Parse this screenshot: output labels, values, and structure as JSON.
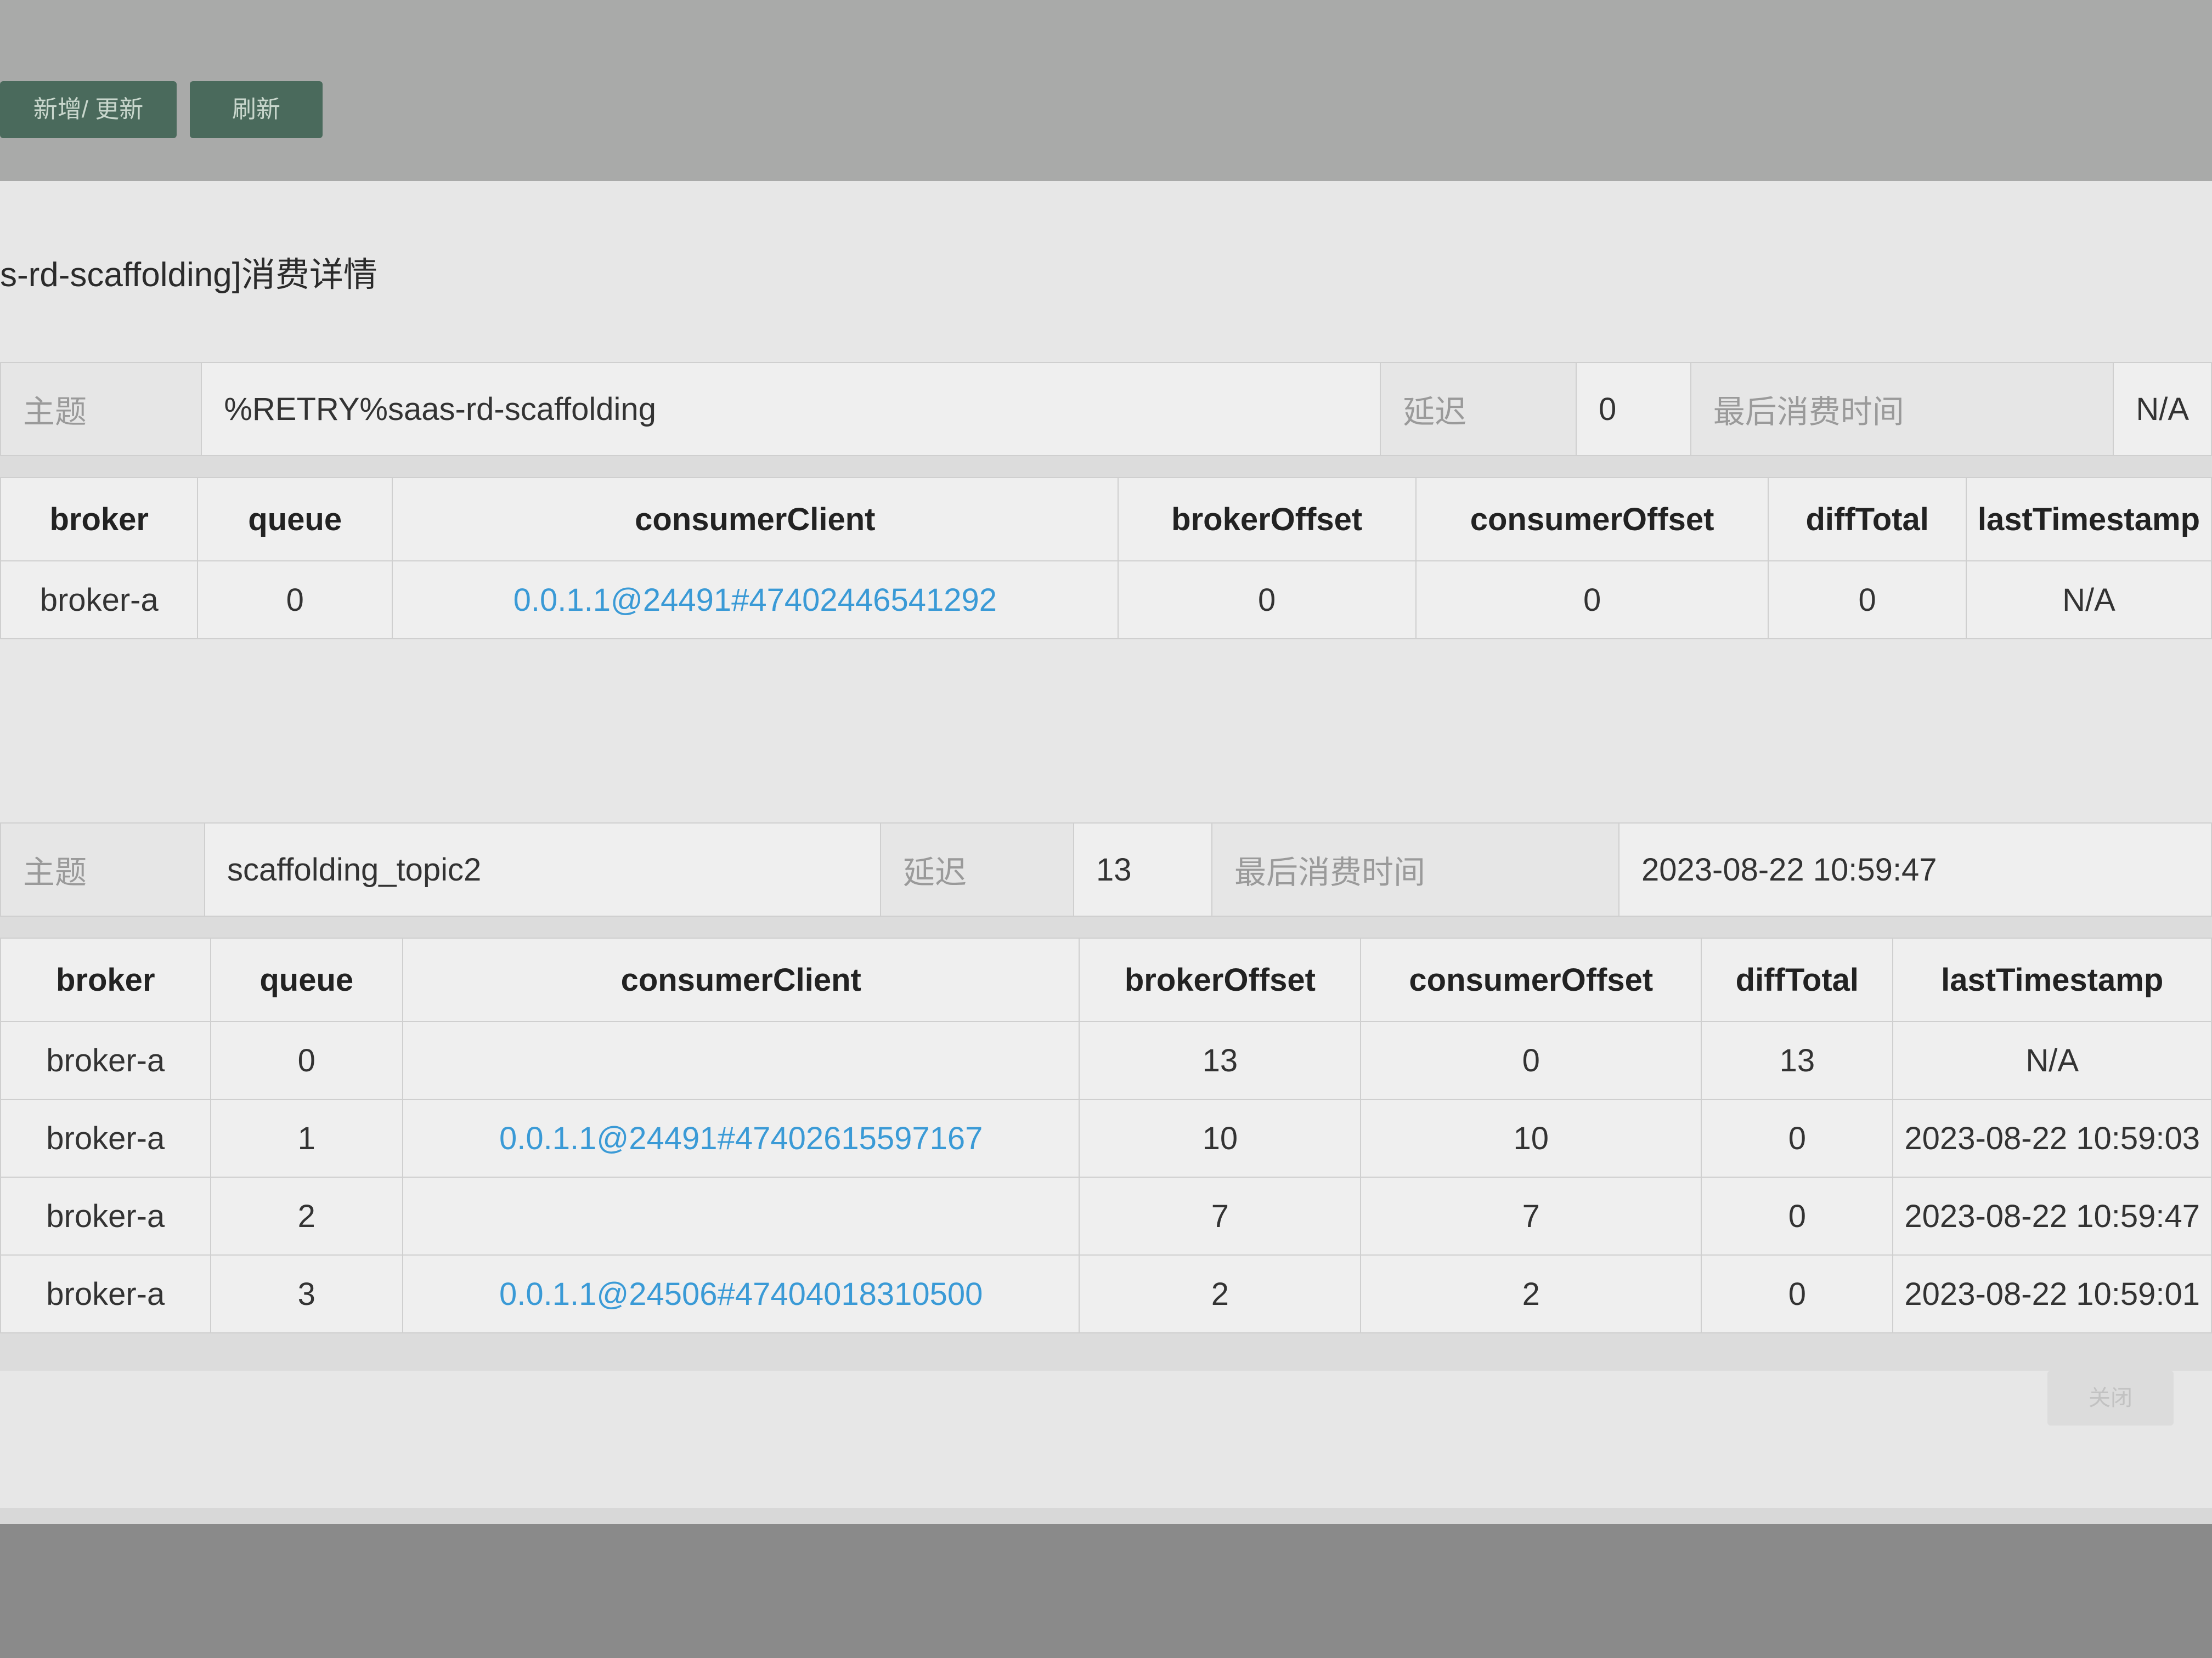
{
  "toolbar": {
    "add_update_label": "新增/ 更新",
    "refresh_label": "刷新"
  },
  "modal": {
    "title": "s-rd-scaffolding]消费详情",
    "close_label": "关闭"
  },
  "labels": {
    "topic": "主题",
    "delay": "延迟",
    "last_consume_time": "最后消费时间"
  },
  "columns": {
    "broker": "broker",
    "queue": "queue",
    "consumerClient": "consumerClient",
    "brokerOffset": "brokerOffset",
    "consumerOffset": "consumerOffset",
    "diffTotal": "diffTotal",
    "lastTimestamp": "lastTimestamp"
  },
  "sections": [
    {
      "topic": "%RETRY%saas-rd-scaffolding",
      "delay": "0",
      "last_consume_time": "N/A",
      "rows": [
        {
          "broker": "broker-a",
          "queue": "0",
          "consumerClient": "0.0.1.1@24491#47402446541292",
          "brokerOffset": "0",
          "consumerOffset": "0",
          "diffTotal": "0",
          "lastTimestamp": "N/A"
        }
      ]
    },
    {
      "topic": "scaffolding_topic2",
      "delay": "13",
      "last_consume_time": "2023-08-22 10:59:47",
      "rows": [
        {
          "broker": "broker-a",
          "queue": "0",
          "consumerClient": "",
          "brokerOffset": "13",
          "consumerOffset": "0",
          "diffTotal": "13",
          "lastTimestamp": "N/A"
        },
        {
          "broker": "broker-a",
          "queue": "1",
          "consumerClient": "0.0.1.1@24491#47402615597167",
          "brokerOffset": "10",
          "consumerOffset": "10",
          "diffTotal": "0",
          "lastTimestamp": "2023-08-22 10:59:03"
        },
        {
          "broker": "broker-a",
          "queue": "2",
          "consumerClient": "",
          "brokerOffset": "7",
          "consumerOffset": "7",
          "diffTotal": "0",
          "lastTimestamp": "2023-08-22 10:59:47"
        },
        {
          "broker": "broker-a",
          "queue": "3",
          "consumerClient": "0.0.1.1@24506#47404018310500",
          "brokerOffset": "2",
          "consumerOffset": "2",
          "diffTotal": "0",
          "lastTimestamp": "2023-08-22 10:59:01"
        }
      ]
    }
  ]
}
